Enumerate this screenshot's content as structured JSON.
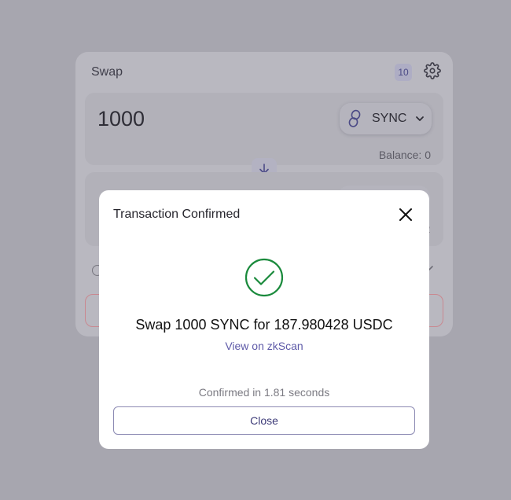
{
  "swap_card": {
    "title": "Swap",
    "badge": "10",
    "from": {
      "amount": "1000",
      "token": "SYNC",
      "balance": "Balance: 0"
    },
    "to": {
      "balance_tail": "2"
    }
  },
  "modal": {
    "title": "Transaction Confirmed",
    "summary": "Swap 1000 SYNC for 187.980428 USDC",
    "explorer_link": "View on zkScan",
    "confirmed_text": "Confirmed in 1.81 seconds",
    "close_label": "Close"
  },
  "colors": {
    "success": "#1a8a3c",
    "link": "#5e5aa8",
    "overlay": "#a7a6af"
  },
  "icons": {
    "settings": "gear-icon",
    "token": "sync-token-icon",
    "dropdown": "chevron-down-icon",
    "swap_direction": "arrow-down-icon",
    "close": "close-icon",
    "success": "check-circle-icon"
  }
}
